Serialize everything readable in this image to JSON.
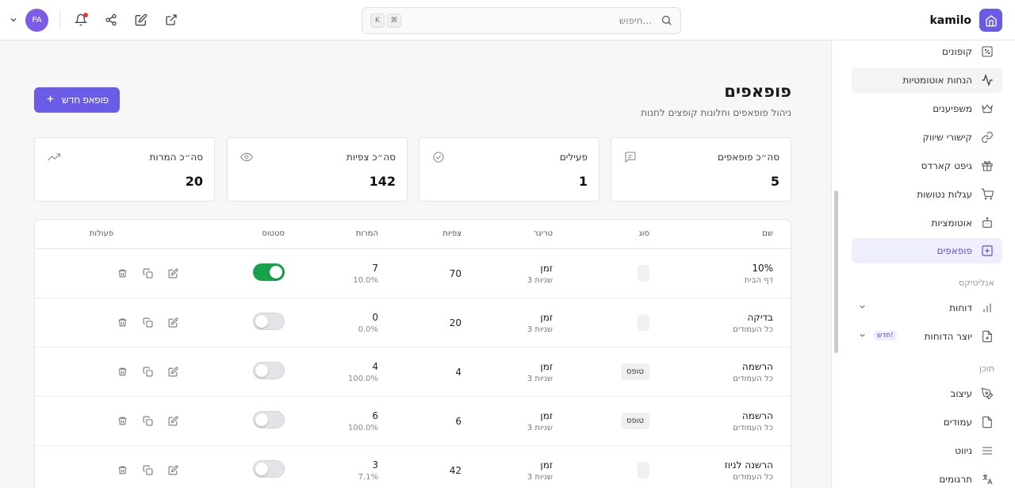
{
  "topbar": {
    "brand": "kamilo",
    "search_placeholder": "חיפוש...",
    "kbd_1": "K",
    "kbd_2": "⌘",
    "avatar_initials": "PA"
  },
  "sidebar": {
    "items": [
      {
        "label": "קופונים",
        "icon": "percent-icon"
      },
      {
        "label": "הנחות אוטומטיות",
        "icon": "activity-icon"
      },
      {
        "label": "משפיענים",
        "icon": "crown-icon"
      },
      {
        "label": "קישורי שיווק",
        "icon": "link-icon"
      },
      {
        "label": "גיפט קארדס",
        "icon": "gift-icon"
      },
      {
        "label": "עגלות נטושות",
        "icon": "cart-icon"
      },
      {
        "label": "אוטומציות",
        "icon": "bot-icon"
      },
      {
        "label": "פופאפים",
        "icon": "plus-square-icon"
      }
    ],
    "section_analytics": "אנליטיקס",
    "analytics_items": [
      {
        "label": "דוחות",
        "icon": "bar-chart-icon"
      },
      {
        "label": "יוצר הדוחות",
        "icon": "file-plus-icon",
        "badge": "חדש!"
      }
    ],
    "section_content": "תוכן",
    "content_items": [
      {
        "label": "עיצוב",
        "icon": "pen-tool-icon"
      },
      {
        "label": "עמודים",
        "icon": "file-icon"
      },
      {
        "label": "ניווט",
        "icon": "menu-icon"
      },
      {
        "label": "תרגומים",
        "icon": "languages-icon"
      }
    ]
  },
  "main": {
    "title": "פופאפים",
    "subtitle": "ניהול פופאפים וחלונות קופצים לחנות",
    "new_button": "פופאפ חדש"
  },
  "stats": [
    {
      "label": "סה״כ פופאפים",
      "value": "5",
      "icon": "message-square-icon"
    },
    {
      "label": "פעילים",
      "value": "1",
      "icon": "check-circle-icon"
    },
    {
      "label": "סה״כ צפיות",
      "value": "142",
      "icon": "eye-icon"
    },
    {
      "label": "סה״כ המרות",
      "value": "20",
      "icon": "trending-up-icon"
    }
  ],
  "table": {
    "headers": {
      "name": "שם",
      "type": "סוג",
      "trigger": "טריגר",
      "views": "צפיות",
      "conversions": "המרות",
      "status": "סטטוס",
      "actions": "פעולות"
    },
    "rows": [
      {
        "name": "10%",
        "page": "דף הבית",
        "type": "",
        "trigger": "זמן",
        "trigger_sub": "3 שניות",
        "views": "70",
        "conversions": "7",
        "conv_rate": "10.0%",
        "active": true
      },
      {
        "name": "בדיקה",
        "page": "כל העמודים",
        "type": "",
        "trigger": "זמן",
        "trigger_sub": "3 שניות",
        "views": "20",
        "conversions": "0",
        "conv_rate": "0.0%",
        "active": false
      },
      {
        "name": "הרשמה",
        "page": "כל העמודים",
        "type": "טופס",
        "trigger": "זמן",
        "trigger_sub": "3 שניות",
        "views": "4",
        "conversions": "4",
        "conv_rate": "100.0%",
        "active": false
      },
      {
        "name": "הרשמה",
        "page": "כל העמודים",
        "type": "טופס",
        "trigger": "זמן",
        "trigger_sub": "3 שניות",
        "views": "6",
        "conversions": "6",
        "conv_rate": "100.0%",
        "active": false
      },
      {
        "name": "הרשנה לניוז",
        "page": "כל העמודים",
        "type": "",
        "trigger": "זמן",
        "trigger_sub": "3 שניות",
        "views": "42",
        "conversions": "3",
        "conv_rate": "7.1%",
        "active": false
      }
    ]
  },
  "colors": {
    "accent": "#6b5ce7",
    "toggle_on": "#16a34a",
    "notification": "#e5383b"
  }
}
